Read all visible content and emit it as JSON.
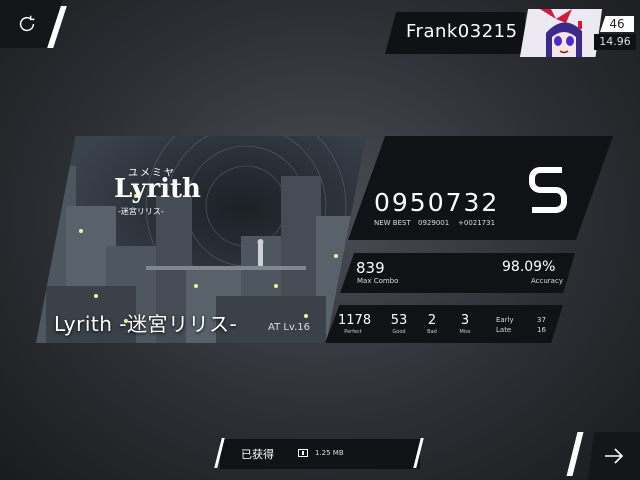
{
  "player": {
    "name": "Frank03215",
    "level": "46",
    "rks": "14.96"
  },
  "song": {
    "title": "Lyrith -迷宮リリス-",
    "difficulty": "AT Lv.16",
    "logo_small": "ユメミヤ",
    "logo_main": "Lyrith",
    "logo_sub": "-迷宮リリス-"
  },
  "result": {
    "score": "0950732",
    "grade": "S",
    "new_best": "NEW BEST",
    "previous_best": "0929001",
    "delta": "+0021731",
    "max_combo": "839",
    "max_combo_label": "Max Combo",
    "accuracy": "98.09%",
    "accuracy_label": "Accuracy",
    "perfect": "1178",
    "perfect_label": "Perfect",
    "good": "53",
    "good_label": "Good",
    "bad": "2",
    "bad_label": "Bad",
    "miss": "3",
    "miss_label": "Miss",
    "early_label": "Early",
    "early": "37",
    "late_label": "Late",
    "late": "16"
  },
  "obtain": {
    "label": "已获得",
    "size": "1.25 MB"
  },
  "icons": {
    "retry": "retry-icon",
    "next": "arrow-right-icon",
    "storage": "storage-icon"
  }
}
